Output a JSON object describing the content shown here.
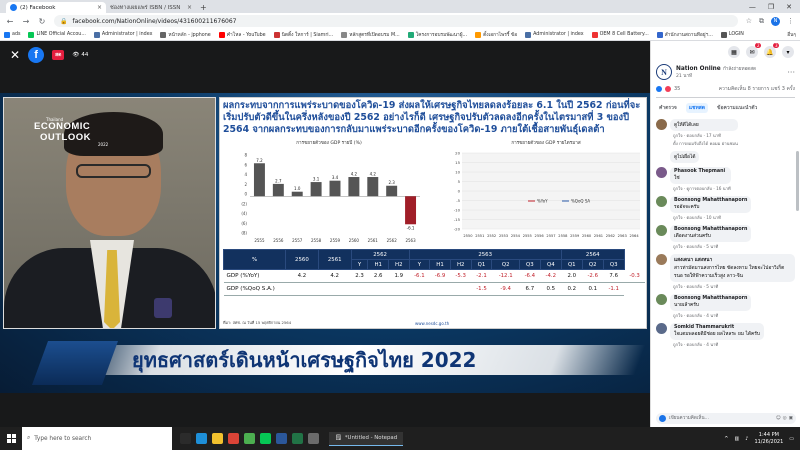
{
  "browser": {
    "tabs": [
      {
        "title": "(2) Facebook",
        "active": true
      },
      {
        "title": "ช่องทางเผยแพร่ ISBN / ISSN",
        "active": false
      }
    ],
    "url": "facebook.com/NationOnline/videos/431600211676067",
    "bookmarks": [
      {
        "label": "ads",
        "color": "#1877f2"
      },
      {
        "label": "LINE Official Accou...",
        "color": "#06c755"
      },
      {
        "label": "Administrator | index",
        "color": "#4a6fa5"
      },
      {
        "label": "หน้าหลัก - jpphone",
        "color": "#666"
      },
      {
        "label": "คำโหล - YouTube",
        "color": "#ff0000"
      },
      {
        "label": "นิตติ้ง ใหการ์ | Siamri...",
        "color": "#c33"
      },
      {
        "label": "หลักสูตรที่เปิดอบรม M...",
        "color": "#888"
      },
      {
        "label": "โครงการอบรมพัฒนาผู้...",
        "color": "#2a7"
      },
      {
        "label": "ตั้งเอกาไพรรี้ ข้อ",
        "color": "#f90"
      },
      {
        "label": "Administrator | index",
        "color": "#4a6fa5"
      },
      {
        "label": "OEM 8 Cell Battery...",
        "color": "#e33"
      },
      {
        "label": "สำนักงานสถานทีอยู่ฯ...",
        "color": "#36c"
      },
      {
        "label": "LOGIN",
        "color": "#555"
      }
    ],
    "bookmarks_more": "อื่นๆ",
    "profile_initial": "N"
  },
  "viewer": {
    "live_label": "สด",
    "viewer_count": "44"
  },
  "slide": {
    "title": "ผลกระทบจากการแพร่ระบาดของโควิด-19 ส่งผลให้เศรษฐกิจไทยลดลงร้อยละ 6.1 ในปี 2562 ก่อนที่จะเริ่มปรับตัวดีขึ้นในครึ่งหลังของปี 2562 อย่างไรก็ดี เศรษฐกิจปรับตัวลดลงอีกครั้งในไตรมาสที่ 3 ของปี 2564 จากผลกระทบของการกลับมาแพร่ระบาดอีกครั้งของโควิด-19 ภายใต้เชื้อสายพันธุ์เดลต้า",
    "footer": "ที่มา: สศช. ณ วันที่ 15 พฤศจิกายน 2564",
    "source_url": "www.nesdc.go.th",
    "table": {
      "header_rows": [
        [
          "%",
          "2560",
          "2561",
          "2562",
          "",
          "",
          "2563",
          "",
          "",
          "",
          "",
          "2564",
          "",
          ""
        ],
        [
          "",
          "",
          "",
          "Y",
          "H1",
          "H2",
          "Y",
          "H1",
          "H2",
          "Q1",
          "Q2",
          "Q3",
          "Q4",
          "Q1",
          "Q2",
          "Q3"
        ]
      ],
      "year_groups": [
        {
          "label": "%"
        },
        {
          "label": "2560"
        },
        {
          "label": "2561"
        },
        {
          "label": "2562",
          "span": 3
        },
        {
          "label": "2563",
          "span": 7
        },
        {
          "label": "2564",
          "span": 3
        }
      ],
      "sub_headers": [
        "Y",
        "H1",
        "H2",
        "Y",
        "H1",
        "H2",
        "Q1",
        "Q2",
        "Q3",
        "Q4",
        "Q1",
        "Q2",
        "Q3"
      ],
      "rows": [
        {
          "label": "GDP (%YoY)",
          "values": [
            "4.2",
            "4.2",
            "2.3",
            "2.6",
            "1.9",
            "-6.1",
            "-6.9",
            "-5.3",
            "-2.1",
            "-12.1",
            "-6.4",
            "-4.2",
            "2.0",
            "-2.6",
            "7.6",
            "-0.3"
          ]
        },
        {
          "label": "GDP (%QoQ S.A.)",
          "values": [
            "",
            "",
            "",
            "",
            "",
            "",
            "",
            "",
            "-1.5",
            "-9.4",
            "6.7",
            "0.5",
            "0.2",
            "0.1",
            "-1.1"
          ]
        }
      ]
    },
    "images": [
      "photo-card-1",
      "photo-card-2",
      "photo-card-3",
      "photo-card-4",
      "photo-card-5"
    ]
  },
  "chart_data": [
    {
      "type": "bar",
      "title": "การขยายตัวของ GDP รายปี (%)",
      "categories": [
        "2555",
        "2556",
        "2557",
        "2558",
        "2559",
        "2560",
        "2561",
        "2562",
        "2563"
      ],
      "values": [
        7.2,
        2.7,
        1.0,
        3.1,
        3.4,
        4.2,
        4.2,
        2.3,
        -6.1
      ],
      "value_labels": [
        "7.2",
        "2.7",
        "1.0",
        "3.1",
        "3.4",
        "4.2",
        "4.2",
        "2.3",
        "-6.1"
      ],
      "ylim": [
        -8,
        9
      ],
      "yticks": [
        "8",
        "6",
        "4",
        "2",
        "0",
        "(2)",
        "(4)",
        "(6)",
        "(8)"
      ],
      "highlight_color": "#a01e28",
      "bar_color": "#555555"
    },
    {
      "type": "line",
      "title": "การขยายตัวของ GDP รายไตรมาส",
      "series": [
        {
          "name": "%YoY"
        },
        {
          "name": "%QoQ SA"
        }
      ],
      "x_labels": [
        "2550",
        "2551",
        "2552",
        "2553",
        "2554",
        "2555",
        "2556",
        "2557",
        "2558",
        "2559",
        "2560",
        "2561",
        "2562",
        "2563",
        "2564"
      ],
      "yticks": [
        "20",
        "15",
        "10",
        "5",
        "0",
        "-5",
        "-10",
        "-15",
        "-20"
      ],
      "ylim": [
        -20,
        20
      ]
    }
  ],
  "banner": {
    "title": "ยุทธศาสตร์เดินหน้าเศรษฐกิจไทย 2022",
    "logo_small": "Thailand",
    "logo_line1": "ECONOMIC",
    "logo_line2": "OUTLOOK",
    "logo_year": "2022"
  },
  "panel": {
    "page_name": "Nation Online",
    "page_name_suffix": "กำลังถ่ายทอดสด",
    "page_time": "21 นาที",
    "reaction_count": "35",
    "comment_stats": "ความคิดเห็น 8 รายการ แชร์ 3 ครั้ง",
    "tabs": [
      "คำตรวจ",
      "แชทสด",
      "ข้อความแนะนำตัว"
    ],
    "comments": [
      {
        "author": "",
        "text": "ดูให้ดีได้เลย",
        "meta": "ถูกใจ · ตอบกลับ · 17 นาที",
        "extra": "ตั้ง การยอมรับถึงได้ คอมม ผ่านชมน",
        "color": "#8a6a4a"
      },
      {
        "author": "",
        "text": "ดูไปเผื่อได้",
        "meta": "",
        "extra": "",
        "color": ""
      },
      {
        "author": "Phasook Thepmani",
        "text": "ใช่",
        "meta": "ถูกใจ · ดูการตอบกลับ · 16 นาที",
        "extra": "",
        "color": "#7a5a8a"
      },
      {
        "author": "Boonsong Mahatthanaporn",
        "text": "รออัจจะครับ",
        "meta": "ถูกใจ · ตอบกลับ · 10 นาที",
        "extra": "",
        "color": "#6a8a5a"
      },
      {
        "author": "Boonsong Mahatthanaporn",
        "text": "เดือดงานส่วนครับ",
        "meta": "ถูกใจ · ตอบกลับ · 5 นาที",
        "extra": "",
        "color": "#6a8a5a"
      },
      {
        "author": "แสงเดนา แสงหนา",
        "text": "สาวท่ามัดมานสงการไทย ขัดลงหาม ใทยจะไปอาวิเก็ตรนอ รอให้ฟ้าความเร็วสูง ลาว-จีน",
        "meta": "ถูกใจ · ตอบกลับ · 5 นาที",
        "extra": "",
        "color": "#9a7a5a"
      },
      {
        "author": "Boonsong Mahatthanaporn",
        "text": "นายเล้าครับ",
        "meta": "ถูกใจ · ตอบกลับ · 4 นาที",
        "extra": "",
        "color": "#6a8a5a"
      },
      {
        "author": "Somkid Thammarukrit",
        "text": "ใจแตมพลอยดีมีช่อย ผลไหลระ ยม ได้ครับ",
        "meta": "ถูกใจ · ตอบกลับ · 4 นาที",
        "extra": "",
        "color": "#5a6a8a"
      }
    ],
    "comment_placeholder": "เขียนความคิดเห็น...",
    "notif_counts": [
      "2",
      "3"
    ]
  },
  "taskbar": {
    "search_placeholder": "Type here to search",
    "notepad_label": "*Untitled - Notepad",
    "time": "1:44 PM",
    "date": "11/26/2021",
    "apps": [
      {
        "name": "task-view",
        "color": "#2b2b2b"
      },
      {
        "name": "edge",
        "color": "#1e8fd8"
      },
      {
        "name": "file-explorer",
        "color": "#f2c12e"
      },
      {
        "name": "chrome-red",
        "color": "#db4437"
      },
      {
        "name": "chrome",
        "color": "#4caf50"
      },
      {
        "name": "line",
        "color": "#06c755"
      },
      {
        "name": "word",
        "color": "#2b579a"
      },
      {
        "name": "excel",
        "color": "#217346"
      },
      {
        "name": "app",
        "color": "#6b6b6b"
      }
    ]
  }
}
